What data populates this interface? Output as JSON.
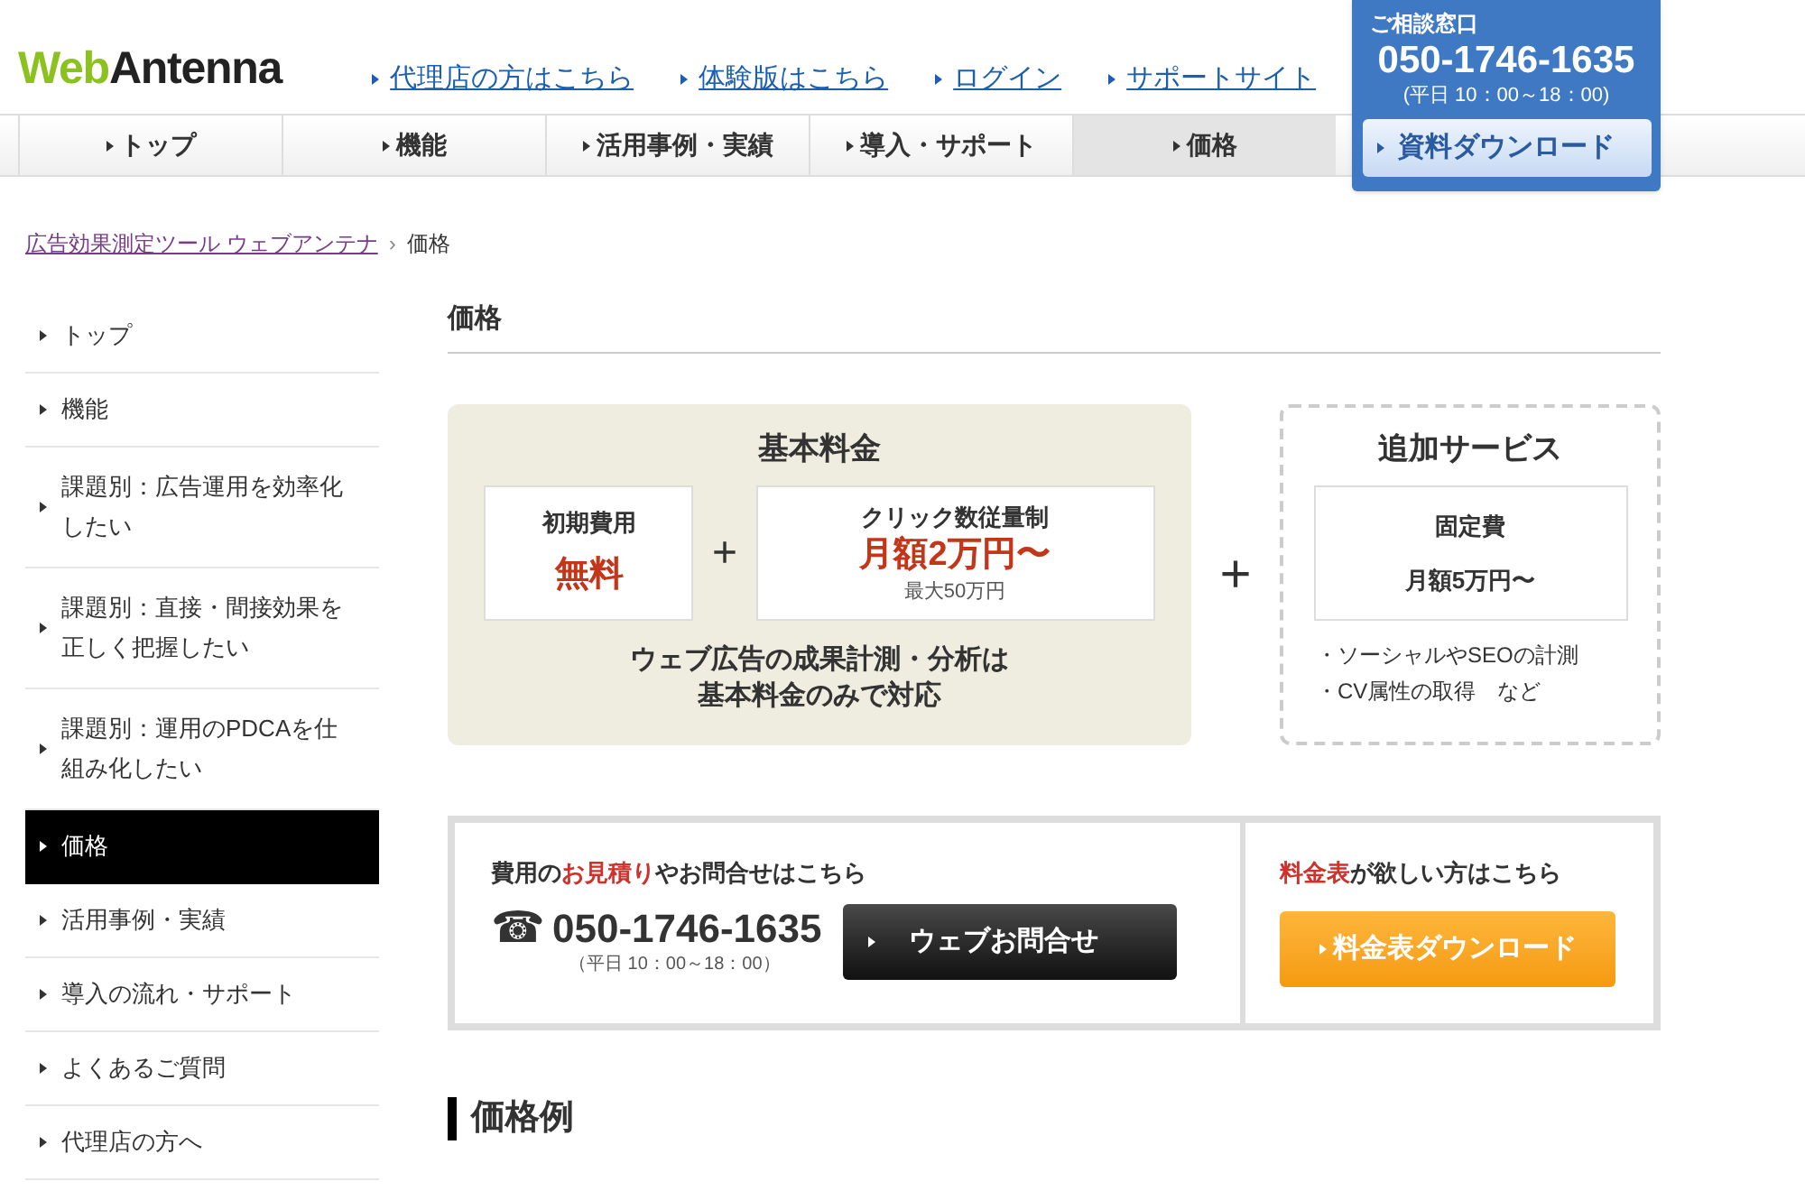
{
  "header": {
    "logo": [
      {
        "text": "Web",
        "kind": "accent"
      },
      {
        "text": "Antenna",
        "kind": "plain"
      }
    ],
    "links": [
      "代理店の方はこちら",
      "体験版はこちら",
      "ログイン",
      "サポートサイト"
    ],
    "contact": {
      "label": "ご相談窓口",
      "phone": "050-1746-1635",
      "hours": "(平日 10：00～18：00)",
      "button": "資料ダウンロード"
    }
  },
  "nav": [
    {
      "label": "トップ",
      "selected": false
    },
    {
      "label": "機能",
      "selected": false
    },
    {
      "label": "活用事例・実績",
      "selected": false
    },
    {
      "label": "導入・サポート",
      "selected": false
    },
    {
      "label": "価格",
      "selected": true
    }
  ],
  "breadcrumb": {
    "link": "広告効果測定ツール ウェブアンテナ",
    "separator": "›",
    "current": "価格"
  },
  "sidebar": [
    {
      "label": "トップ",
      "selected": false
    },
    {
      "label": "機能",
      "selected": false
    },
    {
      "label": "課題別：広告運用を効率化したい",
      "selected": false
    },
    {
      "label": "課題別：直接・間接効果を正しく把握したい",
      "selected": false
    },
    {
      "label": "課題別：運用のPDCAを仕組み化したい",
      "selected": false
    },
    {
      "label": "価格",
      "selected": true
    },
    {
      "label": "活用事例・実績",
      "selected": false
    },
    {
      "label": "導入の流れ・サポート",
      "selected": false
    },
    {
      "label": "よくあるご質問",
      "selected": false
    },
    {
      "label": "代理店の方へ",
      "selected": false
    }
  ],
  "page_title": "価格",
  "pricing": {
    "basic": {
      "title": "基本料金",
      "initial": {
        "label": "初期費用",
        "value": "無料"
      },
      "plus": "+",
      "click": {
        "label": "クリック数従量制",
        "value": "月額2万円〜",
        "note": "最大50万円"
      },
      "description": [
        "ウェブ広告の成果計測・分析は",
        "基本料金のみで対応"
      ]
    },
    "plus": "+",
    "extra": {
      "title": "追加サービス",
      "fixed": {
        "label": "固定費",
        "value": "月額5万円〜"
      },
      "items": [
        "・ソーシャルやSEOの計測",
        "・CV属性の取得　など"
      ]
    }
  },
  "contact_panel": {
    "heading": [
      {
        "text": "費用の",
        "highlight": false
      },
      {
        "text": "お見積り",
        "highlight": true
      },
      {
        "text": "やお問合せはこちら",
        "highlight": false
      }
    ],
    "phone_icon": "☎",
    "phone": "050-1746-1635",
    "hours": "（平日 10：00～18：00）",
    "web_button": "ウェブお問合せ",
    "price_heading": [
      {
        "text": "料金表",
        "highlight": true
      },
      {
        "text": "が欲しい方はこちら",
        "highlight": false
      }
    ],
    "download_button": "料金表ダウンロード"
  },
  "section_title": "価格例"
}
